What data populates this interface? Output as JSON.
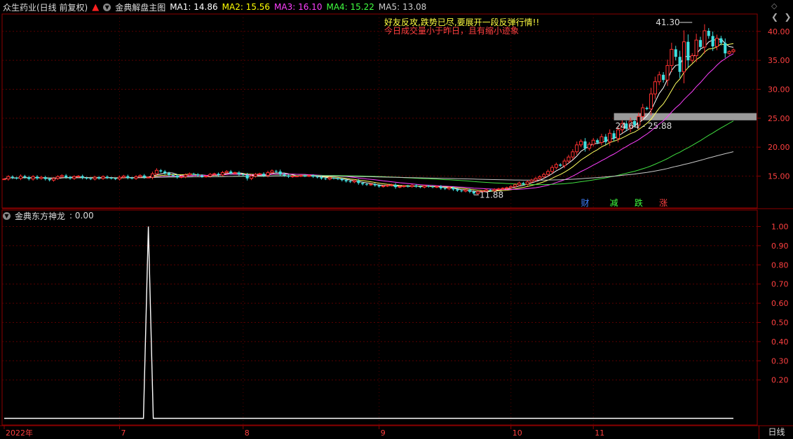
{
  "header": {
    "stock": "众生药业(日线 前复权)",
    "indicator": "金典解盘主图",
    "ma": [
      {
        "label": "MA1:",
        "value": "14.86",
        "color": "#ffffff"
      },
      {
        "label": "MA2:",
        "value": "15.56",
        "color": "#ffff00"
      },
      {
        "label": "MA3:",
        "value": "16.10",
        "color": "#ff40ff"
      },
      {
        "label": "MA4:",
        "value": "15.22",
        "color": "#40ff40"
      },
      {
        "label": "MA5:",
        "value": "13.08",
        "color": "#cccccc"
      }
    ]
  },
  "lower_header": {
    "name": "金典东方神龙",
    "value": ": 0.00"
  },
  "period_label": "日线",
  "colors": {
    "up": "#ff3030",
    "down": "#40e0e0",
    "axis": "#8b0000",
    "grid": "#5a0000"
  },
  "chart_data": [
    {
      "type": "candlestick",
      "y_ticks": [
        "15.00",
        "20.00",
        "25.00",
        "30.00",
        "35.00",
        "40.00"
      ],
      "ylim": [
        9.5,
        43
      ],
      "x_ticks": [
        {
          "label": "2022年",
          "i": 0
        },
        {
          "label": "7",
          "i": 28
        },
        {
          "label": "8",
          "i": 58
        },
        {
          "label": "9",
          "i": 91
        },
        {
          "label": "10",
          "i": 123
        },
        {
          "label": "11",
          "i": 143
        }
      ],
      "annotations": [
        {
          "text": "好友反攻,跌势已尽,要展开一段反弹行情!!",
          "color": "#ffff40"
        },
        {
          "text": "今日成交量小于昨日，且有缩小迹象",
          "color": "#ff4040"
        },
        {
          "text": "41.30",
          "i": 167,
          "value": 41.3
        },
        {
          "text": "11.88",
          "i": 114,
          "value": 11.88
        },
        {
          "text": "24.64 - 25.88",
          "value": 25.26
        }
      ],
      "zone": {
        "low": 24.64,
        "high": 25.88
      },
      "markers": [
        {
          "text": "财",
          "i": 141,
          "color": "#4080ff"
        },
        {
          "text": "减",
          "i": 148,
          "color": "#40ff40"
        },
        {
          "text": "跌",
          "i": 154,
          "color": "#40ff40"
        },
        {
          "text": "涨",
          "i": 160,
          "color": "#ff4040"
        }
      ],
      "close": [
        14.5,
        14.9,
        14.7,
        14.6,
        15.0,
        14.8,
        14.5,
        14.9,
        14.6,
        14.8,
        14.5,
        14.3,
        14.6,
        14.9,
        15.1,
        14.8,
        14.6,
        14.9,
        15.0,
        14.7,
        14.6,
        14.5,
        14.8,
        14.6,
        14.9,
        14.7,
        14.6,
        14.5,
        14.8,
        15.0,
        14.7,
        14.6,
        14.9,
        15.1,
        14.8,
        14.8,
        15.4,
        16.0,
        15.8,
        15.5,
        15.2,
        15.1,
        14.8,
        14.9,
        15.2,
        15.4,
        15.3,
        15.1,
        14.9,
        15.0,
        15.3,
        15.4,
        15.2,
        15.6,
        15.8,
        15.5,
        15.6,
        15.3,
        15.2,
        14.6,
        15.0,
        15.3,
        15.4,
        15.1,
        15.6,
        15.9,
        15.8,
        15.3,
        15.1,
        14.9,
        15.0,
        15.0,
        15.1,
        15.0,
        15.1,
        14.9,
        14.8,
        14.6,
        14.5,
        14.7,
        14.6,
        14.5,
        14.3,
        14.1,
        14.0,
        14.2,
        13.8,
        13.6,
        13.5,
        13.6,
        13.4,
        13.2,
        13.3,
        13.4,
        13.5,
        13.1,
        13.2,
        13.3,
        13.2,
        13.4,
        13.2,
        13.1,
        13.3,
        13.2,
        13.1,
        13.2,
        12.9,
        12.8,
        13.0,
        12.7,
        12.5,
        12.4,
        12.6,
        12.3,
        12.0,
        12.3,
        12.4,
        12.6,
        12.5,
        12.7,
        12.8,
        12.9,
        13.0,
        13.2,
        13.5,
        13.8,
        13.6,
        14.0,
        14.3,
        14.6,
        14.9,
        15.3,
        15.8,
        16.5,
        17.0,
        16.8,
        17.6,
        18.3,
        19.2,
        20.4,
        21.0,
        19.8,
        20.5,
        21.2,
        20.8,
        21.8,
        20.9,
        22.4,
        21.5,
        23.0,
        24.1,
        23.2,
        24.5,
        23.8,
        25.3,
        26.8,
        26.6,
        29.2,
        31.3,
        32.5,
        31.6,
        34.1,
        36.9,
        35.6,
        33.0,
        38.2,
        35.0,
        35.8,
        38.5,
        37.3,
        40.1,
        39.2,
        37.4,
        38.8,
        38.0,
        36.2,
        36.5,
        36.8
      ]
    },
    {
      "type": "line",
      "name": "金典东方神龙",
      "y_ticks": [
        "0.20",
        "0.30",
        "0.40",
        "0.50",
        "0.60",
        "0.70",
        "0.80",
        "0.90",
        "1.00"
      ],
      "ylim": [
        -0.02,
        1.02
      ],
      "spike": {
        "i": 35,
        "value": 1.0
      },
      "baseline": 0.0
    }
  ]
}
